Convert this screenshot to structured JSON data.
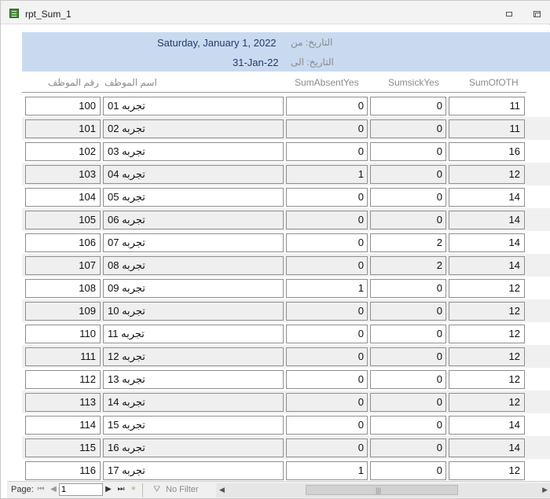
{
  "window": {
    "title": "rpt_Sum_1",
    "icon": "report-icon"
  },
  "header": {
    "from_label": "التاريخ: من",
    "from_value": "Saturday, January 1, 2022",
    "to_label": "التاريخ: الى",
    "to_value": "31-Jan-22"
  },
  "columns": {
    "emp_no": "رقم الموظف",
    "emp_name": "اسم الموظف",
    "absent": "SumAbsentYes",
    "sick": "SumsickYes",
    "oth": "SumOfOTH"
  },
  "rows": [
    {
      "emp_no": "100",
      "emp_name": "تجربه 01",
      "absent": "0",
      "sick": "0",
      "oth": "11"
    },
    {
      "emp_no": "101",
      "emp_name": "تجربه 02",
      "absent": "0",
      "sick": "0",
      "oth": "11"
    },
    {
      "emp_no": "102",
      "emp_name": "تجربه 03",
      "absent": "0",
      "sick": "0",
      "oth": "16"
    },
    {
      "emp_no": "103",
      "emp_name": "تجربه 04",
      "absent": "1",
      "sick": "0",
      "oth": "12"
    },
    {
      "emp_no": "104",
      "emp_name": "تجربه 05",
      "absent": "0",
      "sick": "0",
      "oth": "14"
    },
    {
      "emp_no": "105",
      "emp_name": "تجربه 06",
      "absent": "0",
      "sick": "0",
      "oth": "14"
    },
    {
      "emp_no": "106",
      "emp_name": "تجربه 07",
      "absent": "0",
      "sick": "2",
      "oth": "14"
    },
    {
      "emp_no": "107",
      "emp_name": "تجربه 08",
      "absent": "0",
      "sick": "2",
      "oth": "14"
    },
    {
      "emp_no": "108",
      "emp_name": "تجربه 09",
      "absent": "1",
      "sick": "0",
      "oth": "12"
    },
    {
      "emp_no": "109",
      "emp_name": "تجربه 10",
      "absent": "0",
      "sick": "0",
      "oth": "12"
    },
    {
      "emp_no": "110",
      "emp_name": "تجربه 11",
      "absent": "0",
      "sick": "0",
      "oth": "12"
    },
    {
      "emp_no": "111",
      "emp_name": "تجربه 12",
      "absent": "0",
      "sick": "0",
      "oth": "12"
    },
    {
      "emp_no": "112",
      "emp_name": "تجربه 13",
      "absent": "0",
      "sick": "0",
      "oth": "12"
    },
    {
      "emp_no": "113",
      "emp_name": "تجربه 14",
      "absent": "0",
      "sick": "0",
      "oth": "12"
    },
    {
      "emp_no": "114",
      "emp_name": "تجربه 15",
      "absent": "0",
      "sick": "0",
      "oth": "14"
    },
    {
      "emp_no": "115",
      "emp_name": "تجربه 16",
      "absent": "0",
      "sick": "0",
      "oth": "14"
    },
    {
      "emp_no": "116",
      "emp_name": "تجربه 17",
      "absent": "1",
      "sick": "0",
      "oth": "12"
    }
  ],
  "statusbar": {
    "page_label": "Page:",
    "page_value": "1",
    "filter_label": "No Filter"
  }
}
